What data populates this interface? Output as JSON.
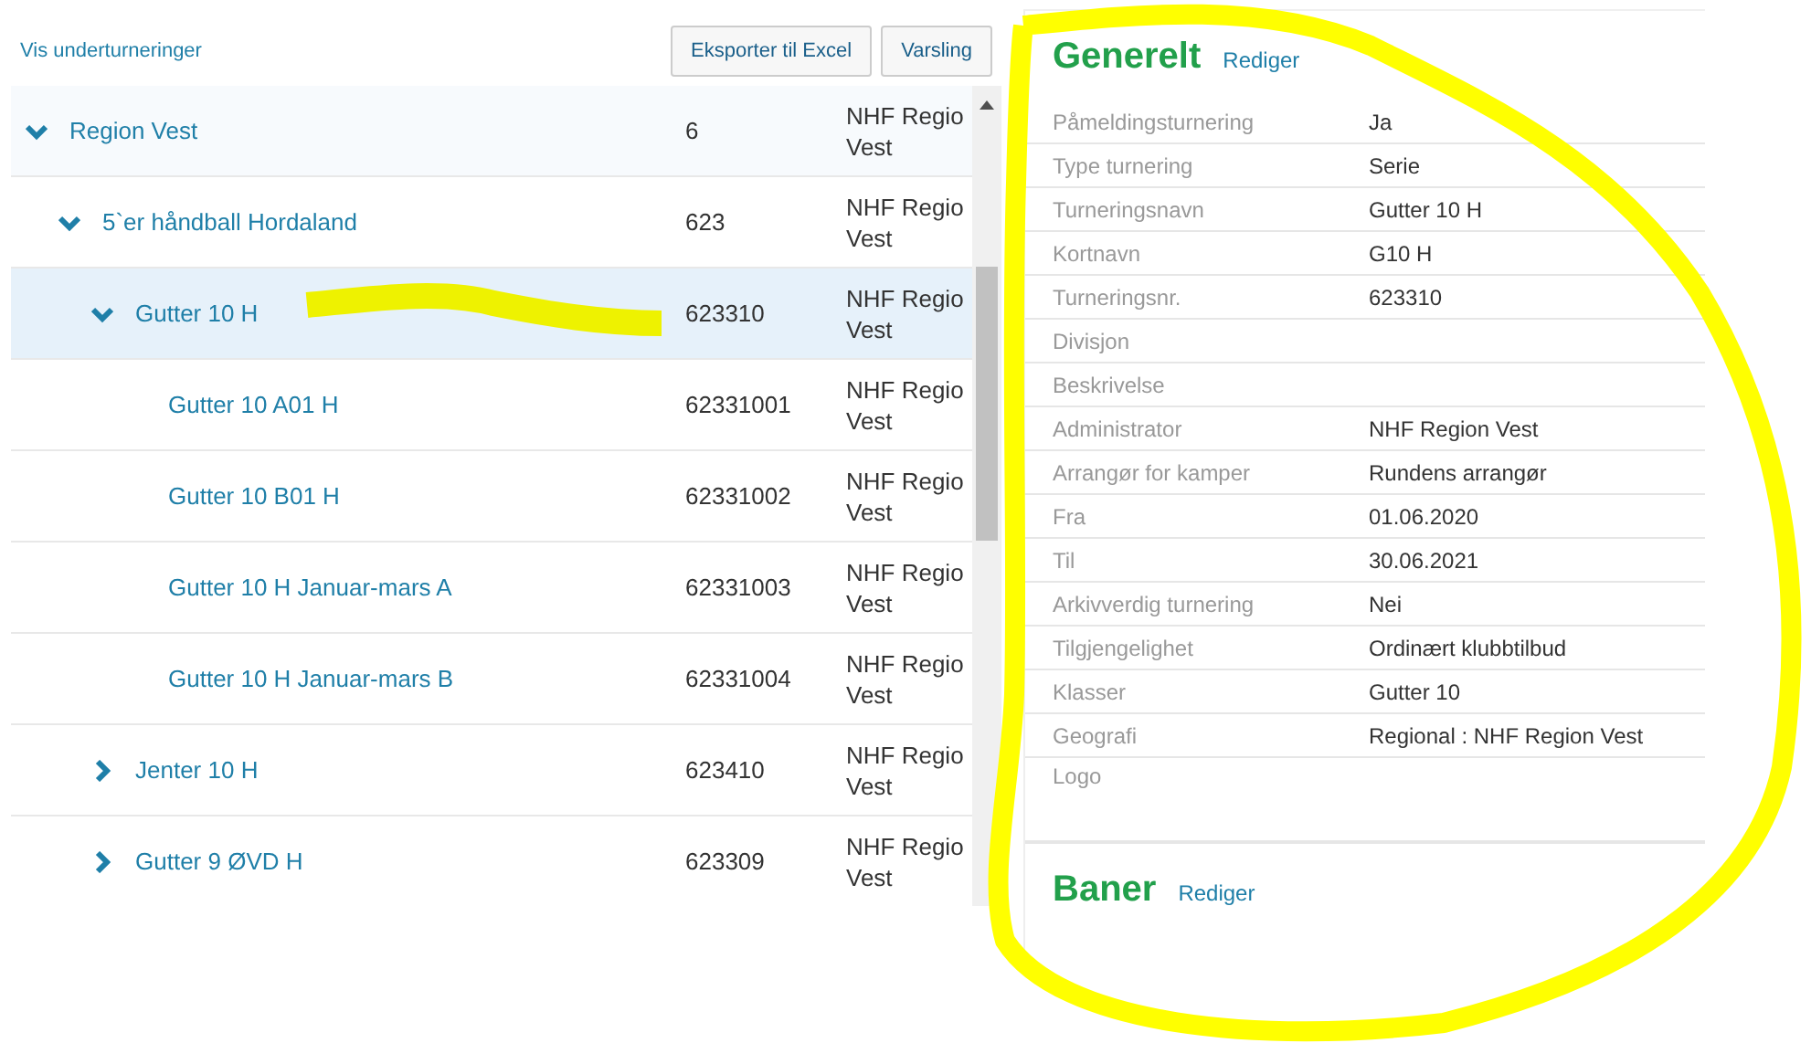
{
  "toolbar": {
    "link": "Vis underturneringer",
    "buttons": [
      "Eksporter til Excel",
      "Varsling"
    ]
  },
  "tree": [
    {
      "name": "Region Vest",
      "number": "6",
      "org": [
        "NHF Regio",
        "Vest"
      ],
      "expanded": true,
      "selected": false,
      "children": [
        {
          "name": "5`er håndball Hordaland",
          "number": "623",
          "org": [
            "NHF Regio",
            "Vest"
          ],
          "expanded": true,
          "selected": false,
          "children": [
            {
              "name": "Gutter 10 H",
              "number": "623310",
              "org": [
                "NHF Regio",
                "Vest"
              ],
              "expanded": true,
              "selected": true,
              "children": [
                {
                  "name": "Gutter 10 A01 H",
                  "number": "62331001",
                  "org": [
                    "NHF Regio",
                    "Vest"
                  ],
                  "selected": false
                },
                {
                  "name": "Gutter 10 B01 H",
                  "number": "62331002",
                  "org": [
                    "NHF Regio",
                    "Vest"
                  ],
                  "selected": false
                },
                {
                  "name": "Gutter 10 H Januar-mars A",
                  "number": "62331003",
                  "org": [
                    "NHF Regio",
                    "Vest"
                  ],
                  "selected": false
                },
                {
                  "name": "Gutter 10 H Januar-mars B",
                  "number": "62331004",
                  "org": [
                    "NHF Regio",
                    "Vest"
                  ],
                  "selected": false
                }
              ]
            },
            {
              "name": "Jenter 10 H",
              "number": "623410",
              "org": [
                "NHF Regio",
                "Vest"
              ],
              "expanded": false,
              "selected": false
            },
            {
              "name": "Gutter 9 ØVD H",
              "number": "623309",
              "org": [
                "NHF Regio",
                "Vest"
              ],
              "expanded": false,
              "selected": false
            }
          ]
        }
      ]
    }
  ],
  "details": {
    "title": "Generelt",
    "edit": "Rediger",
    "fields": [
      {
        "label": "Påmeldingsturnering",
        "value": "Ja"
      },
      {
        "label": "Type turnering",
        "value": "Serie"
      },
      {
        "label": "Turneringsnavn",
        "value": "Gutter 10 H"
      },
      {
        "label": "Kortnavn",
        "value": "G10 H"
      },
      {
        "label": "Turneringsnr.",
        "value": "623310"
      },
      {
        "label": "Divisjon"
      },
      {
        "label": "Beskrivelse"
      },
      {
        "label": "Administrator",
        "value": "NHF Region Vest"
      },
      {
        "label": "Arrangør for kamper",
        "value": "Rundens arrangør"
      },
      {
        "label": "Fra",
        "value": "01.06.2020"
      },
      {
        "label": "Til",
        "value": "30.06.2021"
      },
      {
        "label": "Arkivverdig turnering",
        "value": "Nei"
      },
      {
        "label": "Tilgjengelighet",
        "value": "Ordinært klubbtilbud"
      },
      {
        "label": "Klasser",
        "value": "Gutter 10"
      },
      {
        "label": "Geografi",
        "value": "Regional : NHF Region Vest"
      },
      {
        "label": "Logo"
      }
    ]
  },
  "section2": {
    "title": "Baner",
    "edit": "Rediger"
  }
}
